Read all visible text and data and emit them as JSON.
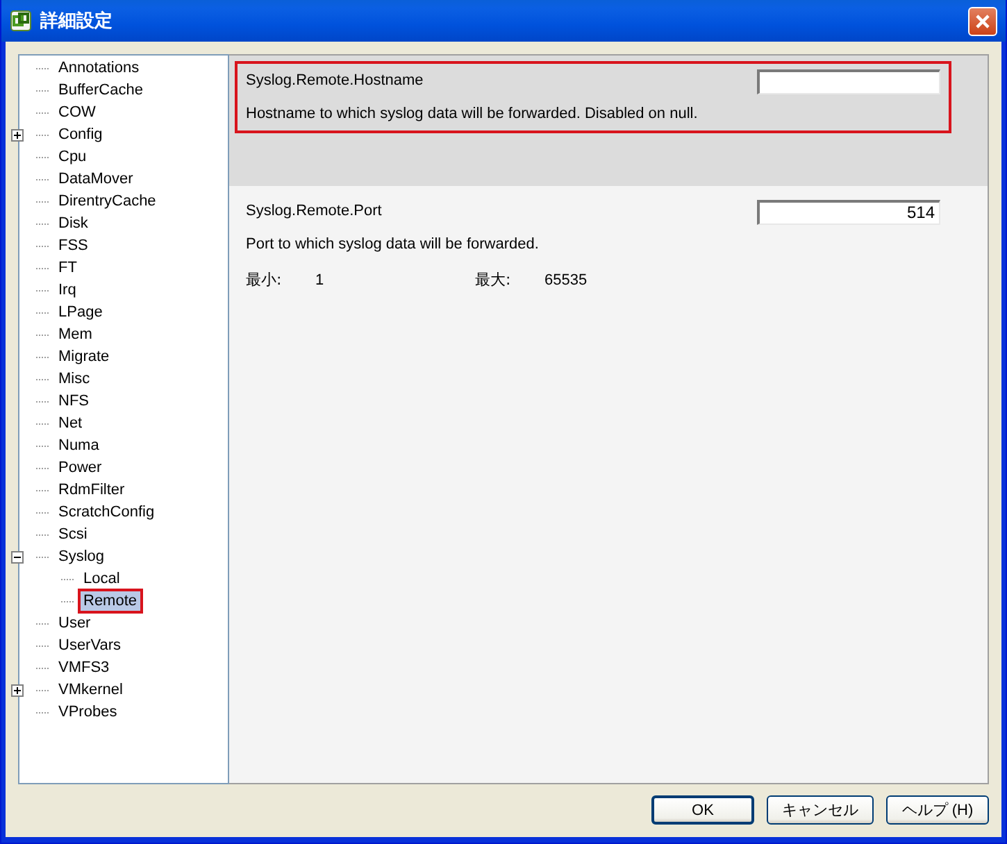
{
  "window": {
    "title": "詳細設定"
  },
  "tree": [
    {
      "label": "Annotations",
      "kind": "leaf",
      "selected": false
    },
    {
      "label": "BufferCache",
      "kind": "leaf",
      "selected": false
    },
    {
      "label": "COW",
      "kind": "leaf",
      "selected": false
    },
    {
      "label": "Config",
      "kind": "folder",
      "expanded": false,
      "selected": false
    },
    {
      "label": "Cpu",
      "kind": "leaf",
      "selected": false
    },
    {
      "label": "DataMover",
      "kind": "leaf",
      "selected": false
    },
    {
      "label": "DirentryCache",
      "kind": "leaf",
      "selected": false
    },
    {
      "label": "Disk",
      "kind": "leaf",
      "selected": false
    },
    {
      "label": "FSS",
      "kind": "leaf",
      "selected": false
    },
    {
      "label": "FT",
      "kind": "leaf",
      "selected": false
    },
    {
      "label": "Irq",
      "kind": "leaf",
      "selected": false
    },
    {
      "label": "LPage",
      "kind": "leaf",
      "selected": false
    },
    {
      "label": "Mem",
      "kind": "leaf",
      "selected": false
    },
    {
      "label": "Migrate",
      "kind": "leaf",
      "selected": false
    },
    {
      "label": "Misc",
      "kind": "leaf",
      "selected": false
    },
    {
      "label": "NFS",
      "kind": "leaf",
      "selected": false
    },
    {
      "label": "Net",
      "kind": "leaf",
      "selected": false
    },
    {
      "label": "Numa",
      "kind": "leaf",
      "selected": false
    },
    {
      "label": "Power",
      "kind": "leaf",
      "selected": false
    },
    {
      "label": "RdmFilter",
      "kind": "leaf",
      "selected": false
    },
    {
      "label": "ScratchConfig",
      "kind": "leaf",
      "selected": false
    },
    {
      "label": "Scsi",
      "kind": "leaf",
      "selected": false
    },
    {
      "label": "Syslog",
      "kind": "folder",
      "expanded": true,
      "selected": false,
      "children": [
        {
          "label": "Local",
          "kind": "leaf",
          "selected": false
        },
        {
          "label": "Remote",
          "kind": "leaf",
          "selected": true
        }
      ]
    },
    {
      "label": "User",
      "kind": "leaf",
      "selected": false
    },
    {
      "label": "UserVars",
      "kind": "leaf",
      "selected": false
    },
    {
      "label": "VMFS3",
      "kind": "leaf",
      "selected": false
    },
    {
      "label": "VMkernel",
      "kind": "folder",
      "expanded": false,
      "selected": false
    },
    {
      "label": "VProbes",
      "kind": "leaf",
      "selected": false
    }
  ],
  "settings": [
    {
      "name": "Syslog.Remote.Hostname",
      "description": "Hostname to which syslog data will be forwarded.  Disabled on null.",
      "selected": true
    },
    {
      "name": "Syslog.Remote.Port",
      "value": "514",
      "description": "Port to which syslog data will be forwarded.",
      "selected": false,
      "min_label": "最小:",
      "min": "1",
      "max_label": "最大:",
      "max": "65535"
    }
  ],
  "buttons": [
    {
      "label": "OK",
      "default": true
    },
    {
      "label": "キャンセル",
      "default": false
    },
    {
      "label": "ヘルプ (H)",
      "default": false
    }
  ]
}
